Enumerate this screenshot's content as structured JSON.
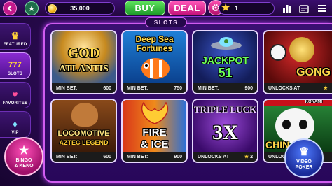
{
  "topbar": {
    "coins": "35,000",
    "buy_label": "BUY",
    "deal_label": "DEAL",
    "level": "1"
  },
  "sidebar": {
    "items": [
      {
        "label": "FEATURED",
        "icon": "crown-icon",
        "active": false
      },
      {
        "label": "SLOTS",
        "icon": "slots-777-icon",
        "active": true
      },
      {
        "label": "FAVORITES",
        "icon": "heart-icon",
        "active": false
      },
      {
        "label": "VIP",
        "icon": "diamond-icon",
        "active": false
      }
    ]
  },
  "panel": {
    "title": "SLOTS"
  },
  "games": [
    {
      "title_line1": "GOD",
      "title_line2": "ATLANTIS",
      "footer_left": "MIN BET:",
      "footer_right": "600"
    },
    {
      "title_line1": "Deep Sea",
      "title_line2": "Fortunes",
      "footer_left": "MIN BET:",
      "footer_right": "750"
    },
    {
      "title_line1": "JACKPOT",
      "title_line2": "51",
      "footer_left": "MIN BET:",
      "footer_right": "900"
    },
    {
      "title_line1": "GONG",
      "title_line2": "",
      "footer_left": "UNLOCKS AT",
      "footer_right": ""
    },
    {
      "title_line1": "LOCOMOTIVE",
      "title_line2": "AZTEC LEGEND",
      "footer_left": "MIN BET:",
      "footer_right": "600"
    },
    {
      "title_line1": "FIRE",
      "title_line2": "& ICE",
      "footer_left": "MIN BET:",
      "footer_right": "900"
    },
    {
      "title_line1": "TRIPLE LUCK",
      "title_line2": "3X",
      "footer_left": "UNLOCKS AT",
      "footer_right": "2"
    },
    {
      "title_line1": "KONAMI",
      "title_line2": "CHIN",
      "footer_left": "UNLOCKS AT",
      "footer_right": ""
    }
  ],
  "floating": {
    "bingo_line1": "BINGO",
    "bingo_line2": "& KENO",
    "video_line1": "VIDEO",
    "video_line2": "POKER"
  }
}
